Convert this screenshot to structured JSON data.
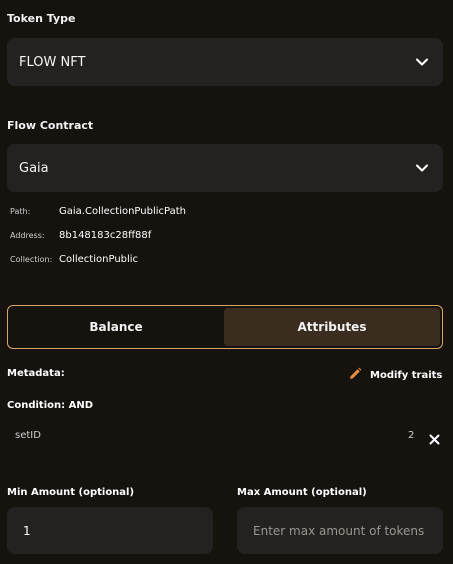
{
  "token_type": {
    "label": "Token Type",
    "value": "FLOW NFT",
    "icon": "chevron-down-icon"
  },
  "flow_contract": {
    "label": "Flow Contract",
    "value": "Gaia",
    "icon": "chevron-down-icon"
  },
  "contract_info": {
    "path_key": "Path:",
    "path_value": "Gaia.CollectionPublicPath",
    "address_key": "Address:",
    "address_value": "8b148183c28ff88f",
    "collection_key": "Collection:",
    "collection_value": "CollectionPublic"
  },
  "tabs": [
    {
      "label": "Balance",
      "active": false
    },
    {
      "label": "Attributes",
      "active": true
    }
  ],
  "metadata": {
    "label": "Metadata:",
    "modify_label": "Modify traits",
    "modify_icon": "pencil-icon",
    "condition": "Condition: AND"
  },
  "traits": [
    {
      "key": "setID",
      "value": "2",
      "remove_icon": "close-icon"
    }
  ],
  "min_amount": {
    "label": "Min Amount (optional)",
    "value": "1"
  },
  "max_amount": {
    "label": "Max Amount (optional)",
    "placeholder": "Enter max amount of tokens",
    "value": ""
  },
  "colors": {
    "accent": "#e8913a",
    "border": "#d9a36a",
    "background": "#16130f",
    "field": "#242220"
  }
}
